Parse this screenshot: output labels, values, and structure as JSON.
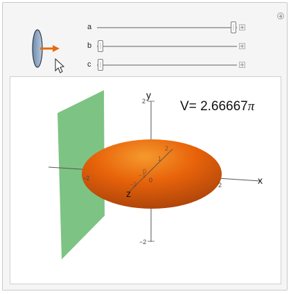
{
  "controls": {
    "sliders": [
      {
        "name": "a",
        "value_fraction": 1.0
      },
      {
        "name": "b",
        "value_fraction": 0.0
      },
      {
        "name": "c",
        "value_fraction": 0.0
      }
    ]
  },
  "plot": {
    "volume_prefix": "V= ",
    "volume_value": "2.66667",
    "volume_pi": "π",
    "axis_x_label": "x",
    "axis_y_label": "y",
    "axis_z_label": "z",
    "tick_y_top": "2",
    "tick_y_bottom": "−2",
    "tick_x_left": "−2",
    "tick_x_right": "2",
    "tick_x_zero": "0",
    "tick_z_1": "1",
    "tick_z_0": "0",
    "tick_z_m1": "−1",
    "tick_z_m2": "−2",
    "tick_z_2": "2",
    "colors": {
      "ellipsoid": "#e8630a",
      "plane": "#6fbd75",
      "slider_thumb": "#fafafa"
    }
  },
  "icons": {
    "corner": "plus-circle-icon",
    "thumbnail": "ellipsoid-arrow-icon",
    "cursor": "mouse-pointer-icon"
  }
}
